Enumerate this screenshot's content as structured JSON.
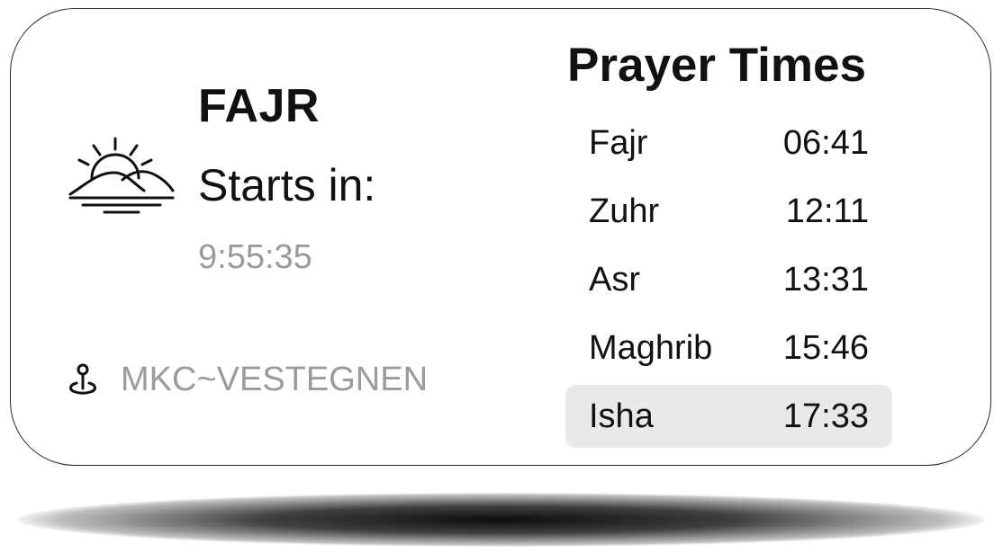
{
  "widget": {
    "prayer_name": "FAJR",
    "starts_in_label": "Starts in:",
    "countdown": "9:55:35",
    "location": "MKC~VESTEGNEN",
    "icons": {
      "weather": "sunrise-icon",
      "location": "location-pin-icon"
    }
  },
  "times": {
    "title": "Prayer Times",
    "rows": [
      {
        "name": "Fajr",
        "time": "06:41",
        "highlighted": false
      },
      {
        "name": "Zuhr",
        "time": "12:11",
        "highlighted": false
      },
      {
        "name": "Asr",
        "time": "13:31",
        "highlighted": false
      },
      {
        "name": "Maghrib",
        "time": "15:46",
        "highlighted": false
      },
      {
        "name": "Isha",
        "time": "17:33",
        "highlighted": true
      }
    ]
  },
  "colors": {
    "text": "#111111",
    "muted": "#9a9a9f",
    "highlight_bg": "#e9e9ec"
  }
}
